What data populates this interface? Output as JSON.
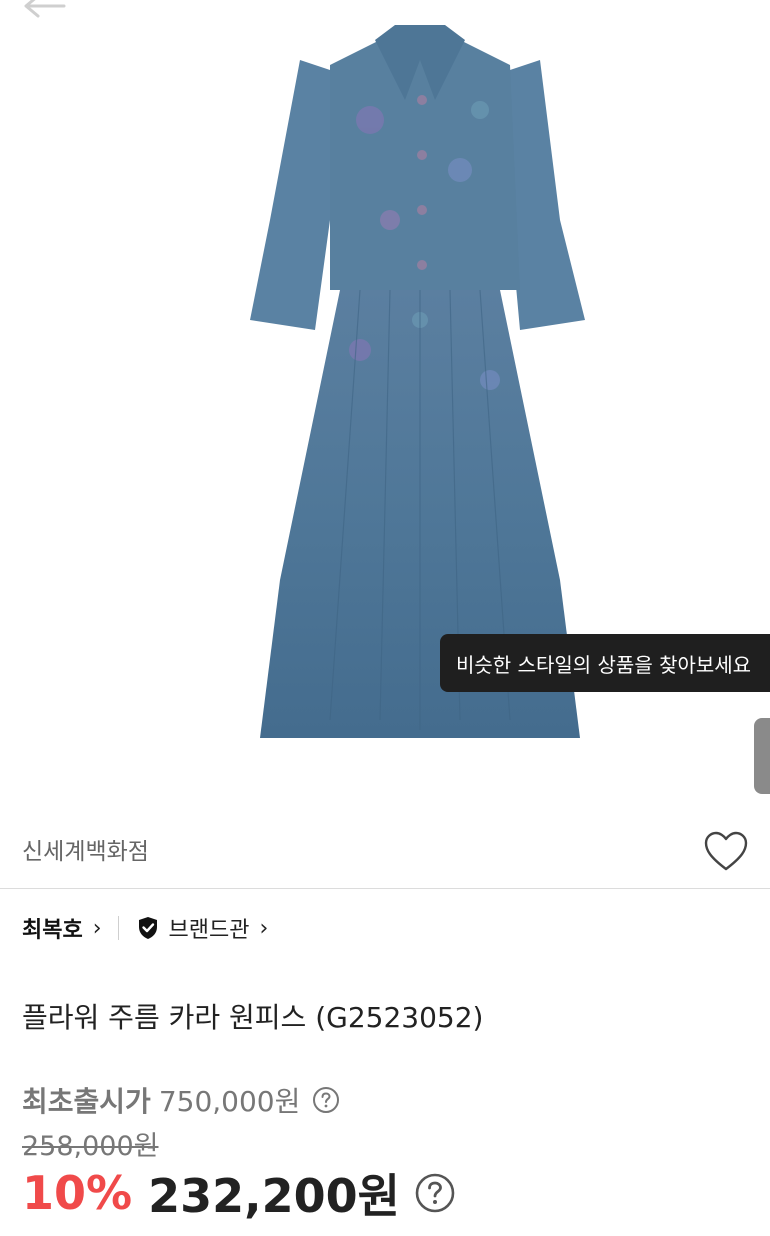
{
  "header": {
    "back_icon": "arrow-left-icon"
  },
  "product_image": {
    "tooltip": "비슷한 스타일의 상품을 찾아보세요"
  },
  "store": {
    "name": "신세계백화점",
    "wishlist_icon": "heart-outline-icon"
  },
  "brand": {
    "name": "최복호",
    "shop_label": "브랜드관",
    "shop_icon": "shield-check-icon",
    "chevron": "›"
  },
  "product": {
    "title": "플라워 주름 카라 원피스 (G2523052)"
  },
  "price": {
    "msrp_label": "최초출시가",
    "msrp_value": "750,000원",
    "original_price": "258,000원",
    "discount_rate": "10%",
    "sale_price": "232,200원",
    "help_icon": "question-circle-icon",
    "accent_color": "#f04a4a"
  }
}
